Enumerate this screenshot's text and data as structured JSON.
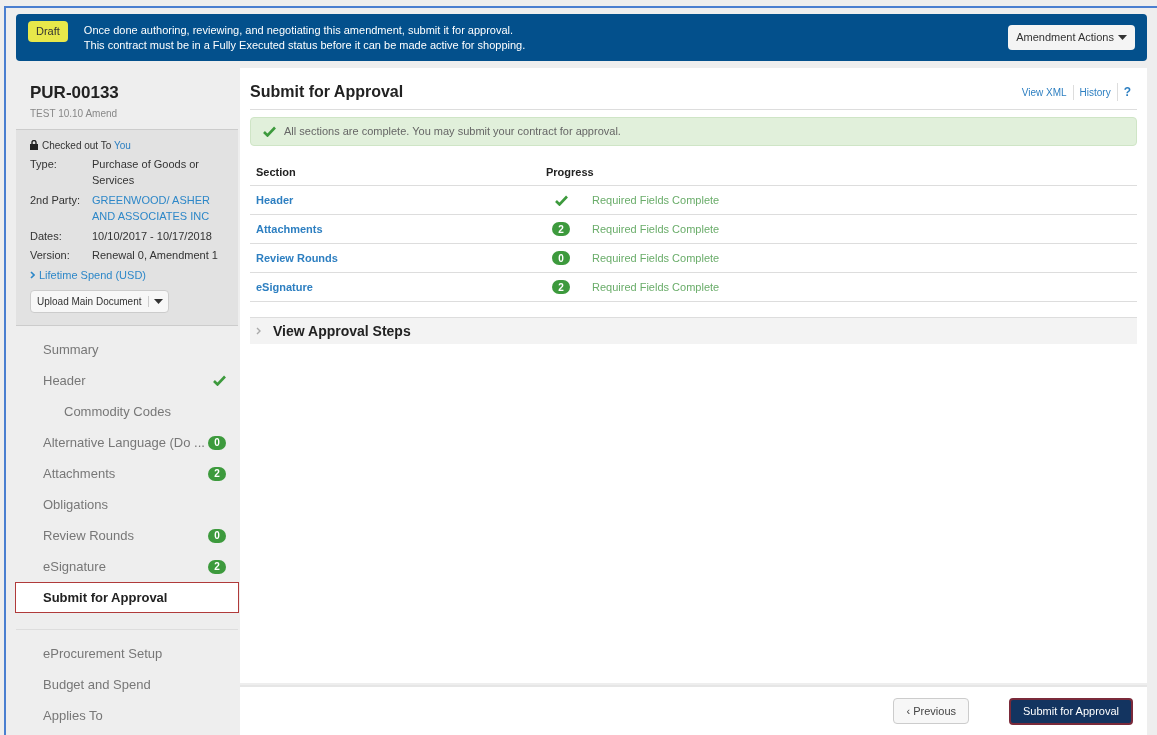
{
  "banner": {
    "status": "Draft",
    "lines": [
      "Once done authoring, reviewing, and negotiating this amendment, submit it for approval.",
      "This contract must be in a Fully Executed status before it can be made active for shopping."
    ],
    "actions_button": "Amendment Actions"
  },
  "contract": {
    "id": "PUR-00133",
    "subtitle": "TEST 10.10 Amend",
    "checked_out_label": "Checked out To",
    "checked_out_user": "You",
    "fields": [
      {
        "label": "Type:",
        "value": "Purchase of Goods or Services",
        "link": false
      },
      {
        "label": "2nd Party:",
        "value": "GREENWOOD/ ASHER AND ASSOCIATES INC",
        "link": true
      },
      {
        "label": "Dates:",
        "value": "10/10/2017 - 10/17/2018",
        "link": false
      },
      {
        "label": "Version:",
        "value": "Renewal 0, Amendment 1",
        "link": false
      }
    ],
    "lifetime_spend": "Lifetime Spend (USD)",
    "upload_button": "Upload Main Document"
  },
  "sidebar": {
    "groups": [
      [
        {
          "label": "Summary",
          "selected": false
        },
        {
          "label": "Header",
          "selected": false,
          "complete": true,
          "children": [
            {
              "label": "Commodity Codes",
              "selected": false
            }
          ]
        },
        {
          "label": "Alternative Language (Do ...",
          "selected": false,
          "count": "0"
        },
        {
          "label": "Attachments",
          "selected": false,
          "count": "2"
        },
        {
          "label": "Obligations",
          "selected": false
        },
        {
          "label": "Review Rounds",
          "selected": false,
          "count": "0"
        },
        {
          "label": "eSignature",
          "selected": false,
          "count": "2"
        },
        {
          "label": "Submit for Approval",
          "selected": true
        }
      ],
      [
        {
          "label": "eProcurement Setup",
          "selected": false
        },
        {
          "label": "Budget and Spend",
          "selected": false
        },
        {
          "label": "Applies To",
          "selected": false
        }
      ]
    ]
  },
  "main": {
    "title": "Submit for Approval",
    "links": [
      "View XML",
      "History",
      "?"
    ],
    "success_message": "All sections are complete. You may submit your contract for approval.",
    "table": {
      "columns": [
        "Section",
        "Progress"
      ],
      "rows": [
        {
          "section": "Header",
          "kind": "check",
          "status": "Required Fields Complete"
        },
        {
          "section": "Attachments",
          "kind": "count",
          "count": "2",
          "status": "Required Fields Complete"
        },
        {
          "section": "Review Rounds",
          "kind": "count",
          "count": "0",
          "status": "Required Fields Complete"
        },
        {
          "section": "eSignature",
          "kind": "count",
          "count": "2",
          "status": "Required Fields Complete"
        }
      ]
    },
    "approval_steps": {
      "label": "View Approval Steps",
      "expanded": false
    }
  },
  "footer": {
    "previous_icon": "‹",
    "previous_button": "Previous",
    "submit_button": "Submit for Approval"
  }
}
